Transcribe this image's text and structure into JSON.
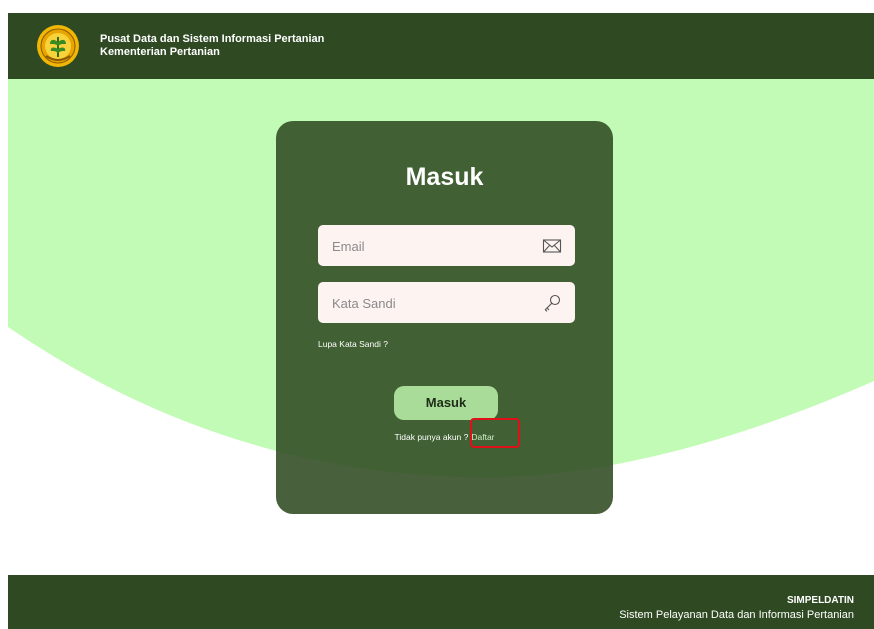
{
  "header": {
    "org_line1": "Pusat Data dan Sistem Informasi Pertanian",
    "org_line2": "Kementerian Pertanian",
    "logo_icon": "ministry-emblem-icon"
  },
  "login": {
    "title": "Masuk",
    "email_placeholder": "Email",
    "email_icon": "envelope-icon",
    "password_placeholder": "Kata Sandi",
    "password_icon": "key-icon",
    "forgot_label": "Lupa Kata Sandi ?",
    "submit_label": "Masuk",
    "no_account_text": "Tidak punya akun ?",
    "register_label": "Daftar"
  },
  "footer": {
    "brand": "SIMPELDATIN",
    "description": "Sistem Pelayanan Data dan Informasi Pertanian"
  },
  "colors": {
    "dark_green": "#2f4a23",
    "light_green": "#c1fbb5",
    "button_green": "#a8dc98",
    "highlight_red": "#e0101a"
  }
}
